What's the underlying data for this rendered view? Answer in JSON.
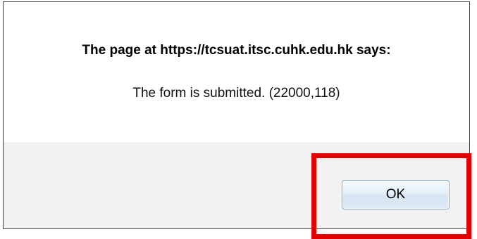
{
  "dialog": {
    "title": "The page at https://tcsuat.itsc.cuhk.edu.hk says:",
    "message": "The form is submitted. (22000,118)",
    "ok_label": "OK"
  },
  "colors": {
    "highlight": "#e30000",
    "footer_background": "#f2f2f2"
  }
}
